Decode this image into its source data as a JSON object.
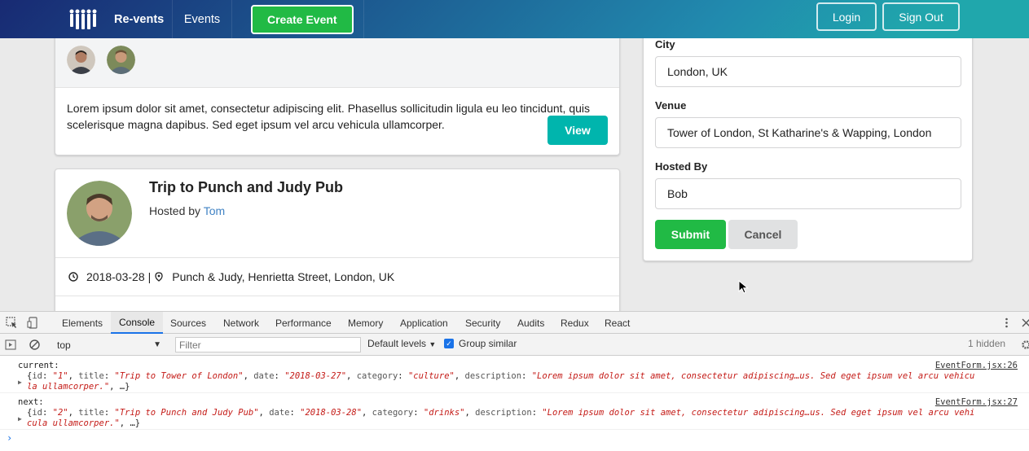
{
  "navbar": {
    "brand": "Re-vents",
    "events": "Events",
    "create_event": "Create Event",
    "login": "Login",
    "sign_out": "Sign Out"
  },
  "event_card_1": {
    "description": "Lorem ipsum dolor sit amet, consectetur adipiscing elit. Phasellus sollicitudin ligula eu leo tincidunt, quis scelerisque magna dapibus. Sed eget ipsum vel arcu vehicula ullamcorper.",
    "view_label": "View"
  },
  "event_card_2": {
    "title": "Trip to Punch and Judy Pub",
    "hosted_by_prefix": "Hosted by",
    "host_name": "Tom",
    "date": "2018-03-28",
    "separator": "|",
    "venue": "Punch & Judy, Henrietta Street, London, UK"
  },
  "form": {
    "city_label": "City",
    "city_value": "London, UK",
    "venue_label": "Venue",
    "venue_value": "Tower of London, St Katharine's & Wapping, London",
    "hosted_by_label": "Hosted By",
    "hosted_by_value": "Bob",
    "submit_label": "Submit",
    "cancel_label": "Cancel"
  },
  "devtools": {
    "tabs": [
      "Elements",
      "Console",
      "Sources",
      "Network",
      "Performance",
      "Memory",
      "Application",
      "Security",
      "Audits",
      "Redux",
      "React"
    ],
    "active_tab": "Console",
    "context": "top",
    "filter_placeholder": "Filter",
    "levels": "Default levels",
    "group_similar": "Group similar",
    "hidden": "1 hidden",
    "logs": [
      {
        "label": "current:",
        "source": "EventForm.jsx:26",
        "id": "\"1\"",
        "title": "\"Trip to Tower of London\"",
        "date": "\"2018-03-27\"",
        "category": "\"culture\"",
        "description": "\"Lorem ipsum dolor sit amet, consectetur adipiscing…us. Sed eget ipsum vel arcu vehicu",
        "description_tail": "la ullamcorper.\"",
        "ellipsis": ", …}"
      },
      {
        "label": "next:",
        "source": "EventForm.jsx:27",
        "id": "\"2\"",
        "title": "\"Trip to Punch and Judy Pub\"",
        "date": "\"2018-03-28\"",
        "category": "\"drinks\"",
        "description": "\"Lorem ipsum dolor sit amet, consectetur adipiscing…us. Sed eget ipsum vel arcu vehi",
        "description_tail": "cula ullamcorper.\"",
        "ellipsis": ", …}"
      }
    ]
  },
  "colors": {
    "nav_gradient_start": "#182a73",
    "nav_gradient_end": "#20a7ac",
    "create_green": "#21ba45",
    "view_teal": "#00b5ad",
    "link_blue": "#4183c4",
    "string_red": "#c41a16"
  }
}
